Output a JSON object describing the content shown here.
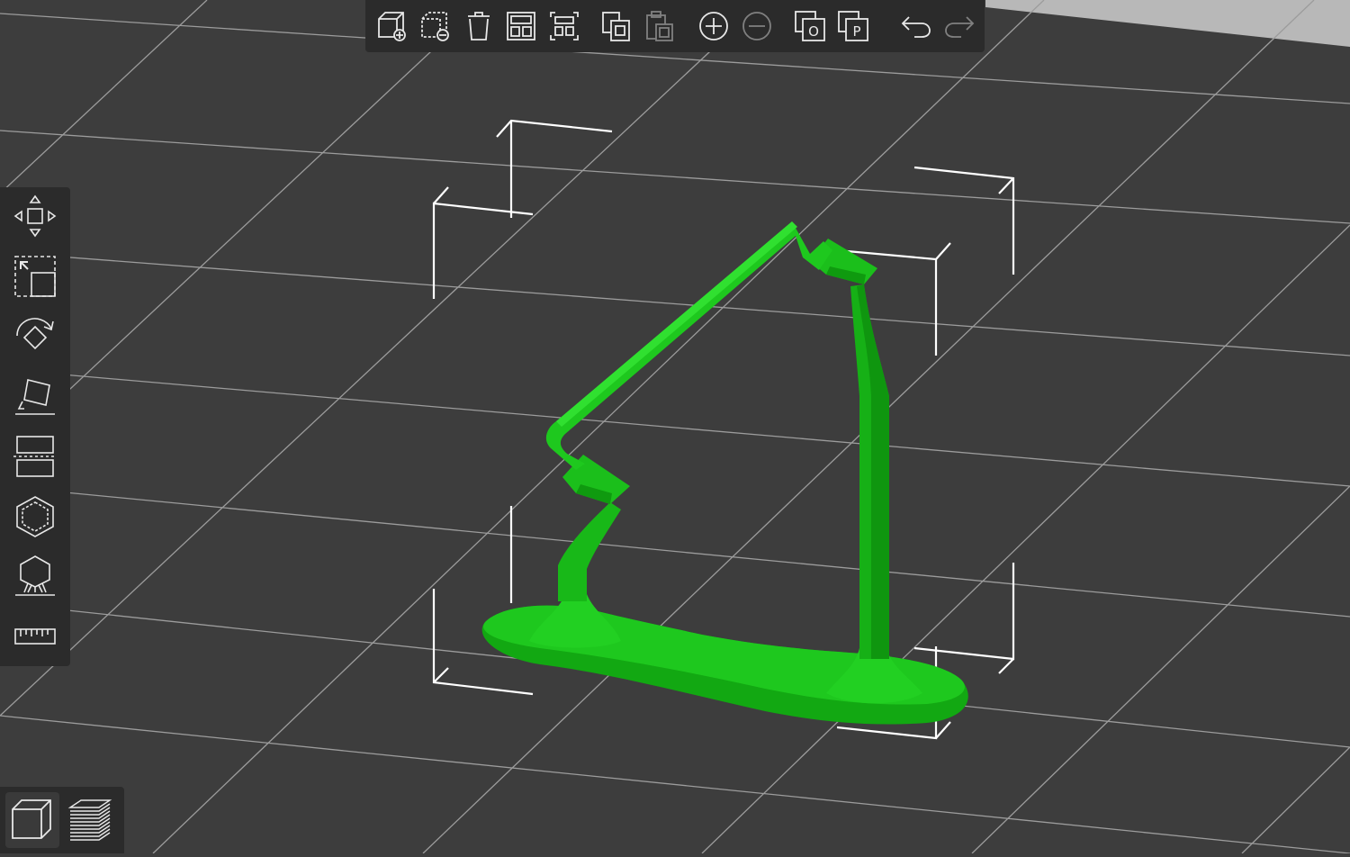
{
  "app": {
    "view": "3D Editor view",
    "accent_color": "#00cc00",
    "background_color": "#3d3d3d",
    "grid_color": "#9a9a9a",
    "bounding_box_color": "#ffffff"
  },
  "top_toolbar": {
    "buttons": [
      {
        "icon": "add-object-icon",
        "enabled": true
      },
      {
        "icon": "delete-object-icon",
        "enabled": true
      },
      {
        "icon": "delete-all-icon",
        "enabled": true
      },
      {
        "icon": "arrange-icon",
        "enabled": true
      },
      {
        "icon": "arrange-selection-icon",
        "enabled": true
      },
      {
        "icon": "copy-icon",
        "enabled": true
      },
      {
        "icon": "paste-icon",
        "enabled": false
      },
      {
        "icon": "add-instance-icon",
        "enabled": true
      },
      {
        "icon": "remove-instance-icon",
        "enabled": false
      },
      {
        "icon": "split-to-objects-icon",
        "enabled": true
      },
      {
        "icon": "split-to-parts-icon",
        "enabled": true
      },
      {
        "icon": "undo-icon",
        "enabled": true
      },
      {
        "icon": "redo-icon",
        "enabled": false
      }
    ],
    "split_objects_letter": "O",
    "split_parts_letter": "P"
  },
  "left_toolbar": {
    "tools": [
      {
        "icon": "move-icon"
      },
      {
        "icon": "scale-icon"
      },
      {
        "icon": "rotate-icon"
      },
      {
        "icon": "place-on-face-icon"
      },
      {
        "icon": "cut-icon"
      },
      {
        "icon": "hollow-icon"
      },
      {
        "icon": "sla-support-points-icon"
      },
      {
        "icon": "measure-icon"
      }
    ]
  },
  "view_switch": {
    "buttons": [
      {
        "icon": "3d-editor-view-icon",
        "active": true
      },
      {
        "icon": "preview-layers-icon",
        "active": false
      }
    ]
  }
}
